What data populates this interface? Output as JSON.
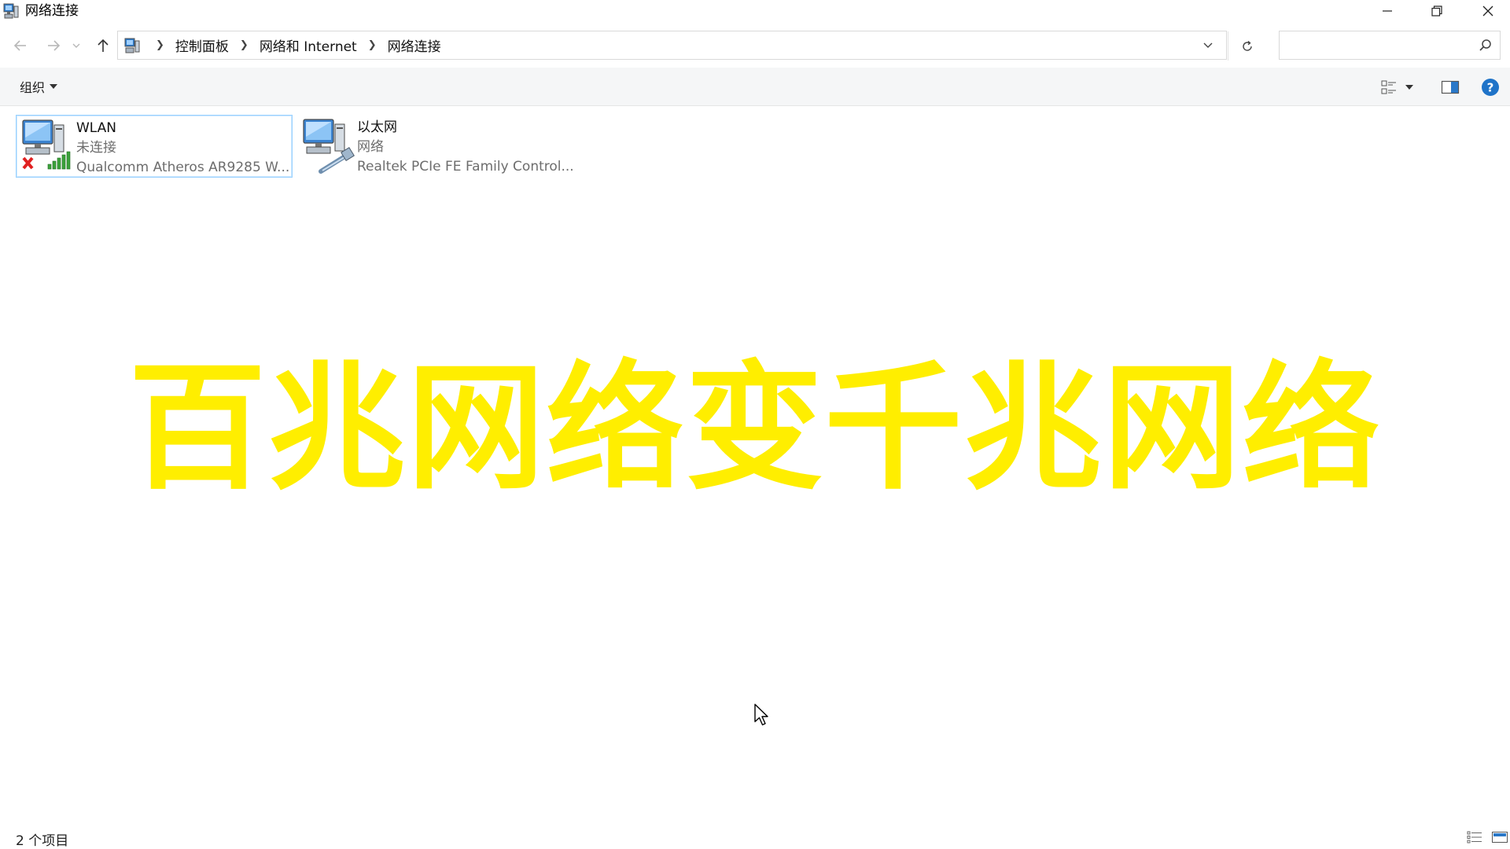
{
  "window": {
    "title": "网络连接"
  },
  "navigation": {
    "breadcrumbs": [
      "控制面板",
      "网络和 Internet",
      "网络连接"
    ],
    "search_placeholder": ""
  },
  "toolbar": {
    "organize_label": "组织"
  },
  "items": [
    {
      "name": "WLAN",
      "status": "未连接",
      "device": "Qualcomm Atheros AR9285 W...",
      "selected": true
    },
    {
      "name": "以太网",
      "status": "网络",
      "device": "Realtek PCIe FE Family Control...",
      "selected": false
    }
  ],
  "overlay_title": "百兆网络变千兆网络",
  "statusbar": {
    "item_count": "2 个项目"
  },
  "colors": {
    "overlay_text": "#ffee00",
    "selection_border": "#99d1ff",
    "help_blue": "#1f73c8",
    "disconnect_red": "#e02020",
    "signal_green": "#3ca23c"
  }
}
